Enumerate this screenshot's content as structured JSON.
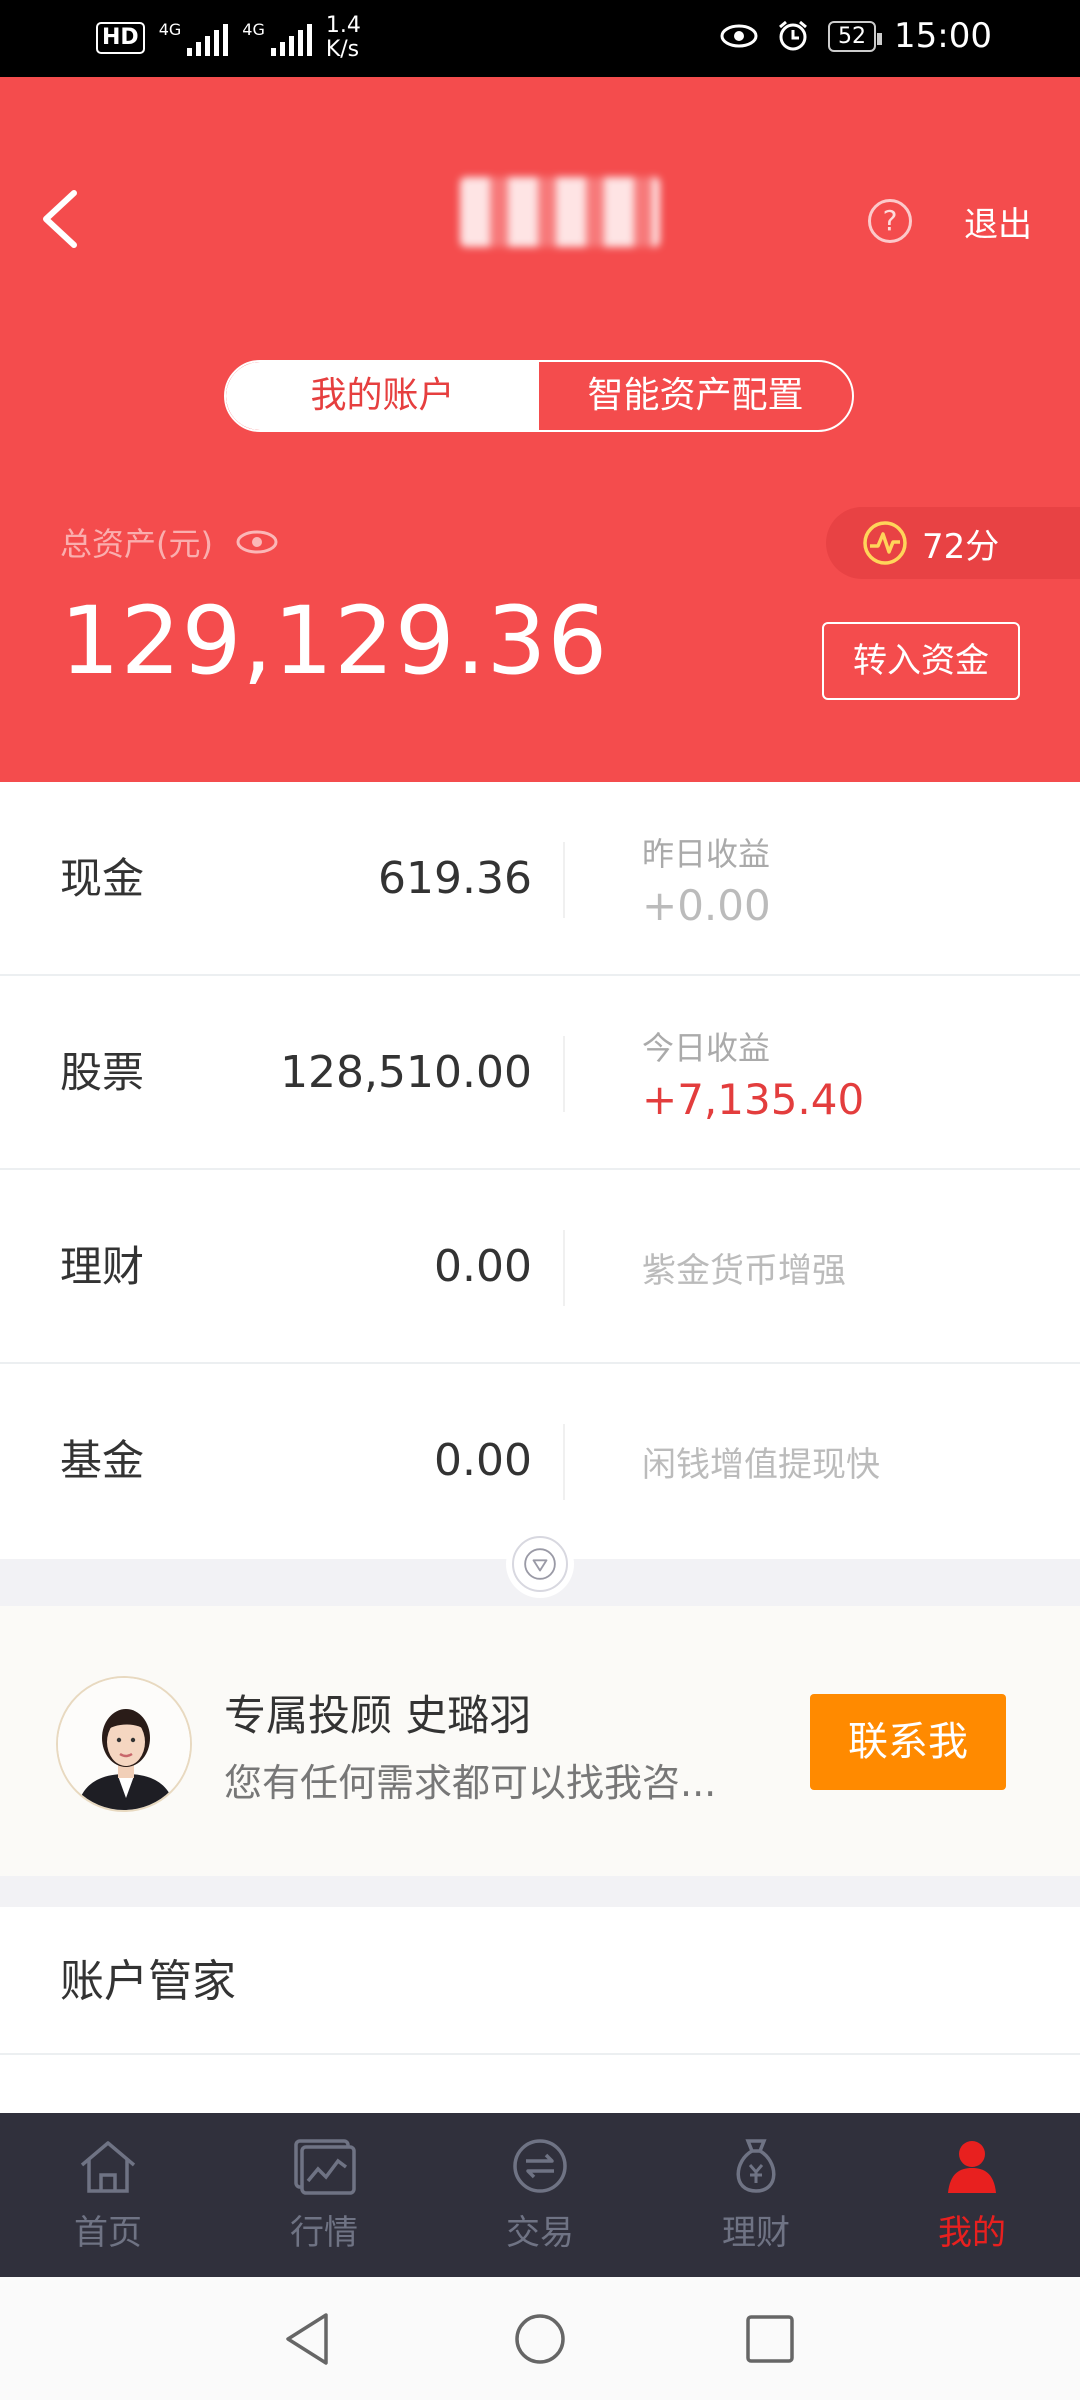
{
  "status_bar": {
    "hd": "HD",
    "sim1": "4G",
    "sim2": "4G",
    "speed_top": "1.4",
    "speed_unit": "K/s",
    "battery": "52",
    "time": "15:00",
    "icons": [
      "eye-icon",
      "alarm-icon",
      "battery-icon"
    ]
  },
  "header": {
    "logout": "退出",
    "help_icon": "question-icon",
    "tabs": [
      "我的账户",
      "智能资产配置"
    ],
    "total_label": "总资产(元)",
    "total_value": "129,129.36",
    "score": "72分",
    "transfer_button": "转入资金"
  },
  "assets": [
    {
      "name": "现金",
      "value": "619.36",
      "info_title": "昨日收益",
      "info_value": "+0.00"
    },
    {
      "name": "股票",
      "value": "128,510.00",
      "info_title": "今日收益",
      "info_value": "+7,135.40"
    },
    {
      "name": "理财",
      "value": "0.00",
      "info_text": "紫金货币增强"
    },
    {
      "name": "基金",
      "value": "0.00",
      "info_text": "闲钱增值提现快"
    }
  ],
  "advisor": {
    "title": "专属投顾 史璐羽",
    "subtitle": "您有任何需求都可以找我咨...",
    "contact_button": "联系我"
  },
  "manager": {
    "title": "账户管家"
  },
  "tabbar": [
    {
      "label": "首页",
      "icon": "home-icon"
    },
    {
      "label": "行情",
      "icon": "chart-icon"
    },
    {
      "label": "交易",
      "icon": "exchange-icon"
    },
    {
      "label": "理财",
      "icon": "money-bag-icon"
    },
    {
      "label": "我的",
      "icon": "user-icon",
      "active": true
    }
  ],
  "colors": {
    "brand_red": "#f44c4d",
    "profit_red": "#e33d3d",
    "contact_orange": "#ff8a00",
    "tabbar_bg": "#30303c"
  }
}
